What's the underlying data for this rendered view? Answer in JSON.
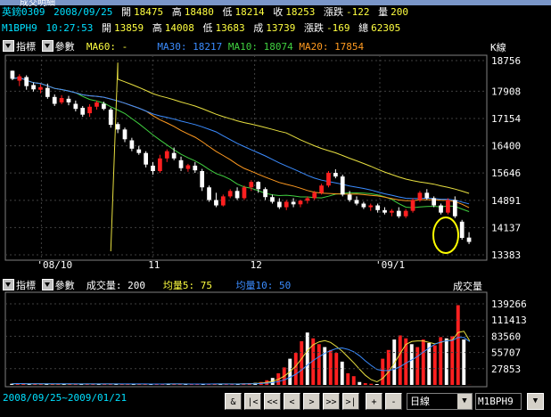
{
  "window": {
    "title": "成交明細"
  },
  "info_row1": {
    "symbol": "英鎊0309",
    "date": "2008/09/25",
    "open_label": "開",
    "open": "18475",
    "high_label": "高",
    "high": "18480",
    "low_label": "低",
    "low": "18214",
    "close_label": "收",
    "close": "18253",
    "change_label": "漲跌",
    "change": "-122",
    "vol_label": "量",
    "vol": "200"
  },
  "info_row2": {
    "symbol": "M1BPH9",
    "time": "10:27:53",
    "open_label": "開",
    "open": "13859",
    "high_label": "高",
    "high": "14008",
    "low_label": "低",
    "low": "13683",
    "close_label": "成",
    "close": "13739",
    "change_label": "漲跌",
    "change": "-169",
    "total_label": "總",
    "total": "62305"
  },
  "price_toolbar": {
    "indicator_label": "指標",
    "param_label": "參數",
    "ma60": "MA60: -",
    "ma30": "MA30: 18217",
    "ma10": "MA10: 18074",
    "ma20": "MA20: 17854",
    "kline_label": "K線"
  },
  "volume_toolbar": {
    "indicator_label": "指標",
    "param_label": "參數",
    "vol": "成交量: 200",
    "avg5": "均量5: 75",
    "avg10": "均量10: 50",
    "vol_label": "成交量"
  },
  "colors": {
    "up": "#ff2020",
    "down": "#ffffff",
    "ma30": "#3b8cff",
    "ma10": "#40d040",
    "ma20": "#ff9a20",
    "ma60": "#e8e040",
    "highlight": "#ffff00"
  },
  "bottom": {
    "date_range": "2008/09/25~2009/01/21",
    "nav": [
      "&",
      "|<",
      "<<",
      "<",
      ">",
      ">>",
      ">|",
      "+",
      "-"
    ],
    "period": "日線",
    "code": "M1BPH9"
  },
  "chart_data": [
    {
      "type": "candlestick",
      "title": "",
      "x_ticks": [
        "'08/10",
        "11",
        "12",
        "'09/1"
      ],
      "y_ticks": [
        18756,
        17908,
        17154,
        16400,
        15646,
        14891,
        14137,
        13383
      ],
      "ylim": [
        13383,
        18756
      ],
      "grid": true,
      "ohlc": [
        [
          18475,
          18480,
          18214,
          18253
        ],
        [
          18200,
          18380,
          18050,
          18320
        ],
        [
          18300,
          18350,
          17950,
          18050
        ],
        [
          18080,
          18150,
          17900,
          17960
        ],
        [
          17950,
          18100,
          17850,
          18020
        ],
        [
          18000,
          18120,
          17700,
          17750
        ],
        [
          17750,
          17820,
          17500,
          17560
        ],
        [
          17600,
          17800,
          17550,
          17720
        ],
        [
          17700,
          17780,
          17520,
          17600
        ],
        [
          17560,
          17650,
          17350,
          17420
        ],
        [
          17450,
          17500,
          17200,
          17260
        ],
        [
          17300,
          17550,
          17200,
          17480
        ],
        [
          17480,
          17650,
          17400,
          17600
        ],
        [
          17560,
          17620,
          17380,
          17420
        ],
        [
          17400,
          17450,
          16900,
          16980
        ],
        [
          17000,
          17050,
          16750,
          16850
        ],
        [
          16850,
          16900,
          16500,
          16580
        ],
        [
          16550,
          16620,
          16250,
          16320
        ],
        [
          16300,
          16400,
          16150,
          16200
        ],
        [
          16200,
          16250,
          15800,
          15880
        ],
        [
          15850,
          15950,
          15600,
          15700
        ],
        [
          15700,
          16150,
          15650,
          16050
        ],
        [
          16050,
          16300,
          15950,
          16250
        ],
        [
          16200,
          16350,
          16000,
          16050
        ],
        [
          16000,
          16100,
          15700,
          15780
        ],
        [
          15760,
          15900,
          15680,
          15860
        ],
        [
          15850,
          15950,
          15650,
          15720
        ],
        [
          15700,
          15760,
          15150,
          15250
        ],
        [
          15250,
          15300,
          14850,
          14900
        ],
        [
          14900,
          15100,
          14700,
          14750
        ],
        [
          14750,
          15050,
          14720,
          15000
        ],
        [
          15000,
          15200,
          14950,
          15150
        ],
        [
          15150,
          15250,
          14900,
          14950
        ],
        [
          14950,
          15300,
          14900,
          15250
        ],
        [
          15250,
          15450,
          15150,
          15400
        ],
        [
          15400,
          15420,
          15100,
          15200
        ],
        [
          15200,
          15250,
          14900,
          14980
        ],
        [
          14980,
          15050,
          14800,
          14850
        ],
        [
          14850,
          14950,
          14650,
          14700
        ],
        [
          14700,
          14900,
          14620,
          14850
        ],
        [
          14850,
          14950,
          14700,
          14780
        ],
        [
          14780,
          14900,
          14700,
          14880
        ],
        [
          14880,
          15000,
          14800,
          14950
        ],
        [
          14950,
          15150,
          14900,
          15100
        ],
        [
          15100,
          15350,
          15050,
          15300
        ],
        [
          15300,
          15700,
          15250,
          15650
        ],
        [
          15650,
          15750,
          15500,
          15550
        ],
        [
          15550,
          15600,
          15000,
          15050
        ],
        [
          15050,
          15150,
          14850,
          14900
        ],
        [
          14900,
          15000,
          14750,
          14800
        ],
        [
          14800,
          14850,
          14650,
          14700
        ],
        [
          14700,
          14800,
          14600,
          14750
        ],
        [
          14750,
          14800,
          14550,
          14620
        ],
        [
          14620,
          14700,
          14500,
          14550
        ],
        [
          14550,
          14650,
          14450,
          14600
        ],
        [
          14600,
          14700,
          14400,
          14450
        ],
        [
          14450,
          14650,
          14400,
          14600
        ],
        [
          14600,
          14950,
          14550,
          14900
        ],
        [
          14900,
          15150,
          14850,
          15100
        ],
        [
          15100,
          15200,
          14900,
          14950
        ],
        [
          14950,
          15000,
          14700,
          14750
        ],
        [
          14750,
          14800,
          14500,
          14550
        ],
        [
          14550,
          14950,
          14500,
          14900
        ],
        [
          14900,
          15000,
          14400,
          14450
        ],
        [
          14300,
          14350,
          13800,
          13850
        ],
        [
          13860,
          14010,
          13680,
          13740
        ]
      ]
    },
    {
      "type": "bar",
      "title": "",
      "y_ticks": [
        139266,
        111413,
        83560,
        55707,
        27853
      ],
      "ylim": [
        0,
        150000
      ],
      "values": [
        2000,
        2500,
        2000,
        1500,
        1800,
        2200,
        1500,
        1700,
        1500,
        1800,
        2000,
        1600,
        1500,
        1700,
        2000,
        1800,
        1600,
        1500,
        1400,
        1500,
        1800,
        1600,
        1500,
        1400,
        1600,
        1500,
        2000,
        1800,
        1500,
        1400,
        1600,
        1500,
        1400,
        1500,
        1800,
        1600,
        2000,
        1500,
        1400,
        1600,
        2500,
        3000,
        3500,
        5000,
        8000,
        12000,
        20000,
        30000,
        45000,
        55000,
        75000,
        90000,
        80000,
        70000,
        65000,
        60000,
        55000,
        40000,
        20000,
        15000,
        5000,
        3000,
        2000,
        1500,
        45000,
        60000,
        78000,
        85000,
        80000,
        70000,
        65000,
        78000,
        72000,
        68000,
        82000,
        80000,
        84000,
        137000,
        78000,
        200
      ]
    }
  ]
}
